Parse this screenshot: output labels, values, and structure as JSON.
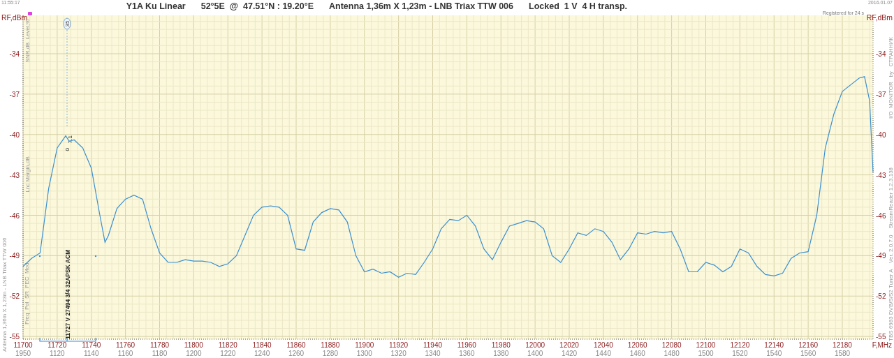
{
  "header": {
    "time": "11:55:17",
    "title_parts": [
      "Y1A Ku Linear",
      "52°5E  @  47.51°N : 19.20°E",
      "Antenna 1,36m X 1,23m - LNB Triax TTW 006",
      "Locked  1 V  4 H transp."
    ],
    "date": "2016.01.07",
    "registered": "Registered for 24 s"
  },
  "left_labels": {
    "ytick_labels": [
      "-34",
      "-37",
      "-40",
      "-43",
      "-46",
      "-49",
      "-52",
      "-55"
    ],
    "scales": [
      "Level,%",
      "SNR,dB",
      "Lnc Margin,dB"
    ],
    "info_fields": "Freq  Pol  SR  FEC  Mod",
    "antenna": "Antenna 1,36m X 1,23m - LNB Triax TTW 006"
  },
  "right_labels": {
    "unit": "RF,dBm",
    "brand": "I/O  MONITOR   by   СТРАННИК",
    "device": "TBS 6983 DVB/S/S2 Tuner A    Ver. 2.0.7.0    StreamReader 1.2.3.138"
  },
  "marker": {
    "badge": "35",
    "readings": [
      "0",
      "7.1"
    ],
    "transponder": "11727 V 27494 3/4 32APSK ACM"
  },
  "spectrum": {
    "secondary_xtick_labels": [
      "1950",
      "1120",
      "1140",
      "1160",
      "1180",
      "1200",
      "1220",
      "1240",
      "1260",
      "1280",
      "1300",
      "1320",
      "1340",
      "1360",
      "1380",
      "1400",
      "1420",
      "1440",
      "1460",
      "1480",
      "1500",
      "1520",
      "1540",
      "1560",
      "1580"
    ],
    "chart_data": {
      "type": "line",
      "ylabel": "RF,dBm",
      "xlabel": "F,MHz",
      "xlim": [
        11700,
        12198
      ],
      "ylim": [
        -55.2,
        -31.15
      ],
      "grid": true,
      "xticks": [
        11700,
        11720,
        11740,
        11760,
        11780,
        11800,
        11820,
        11840,
        11860,
        11880,
        11900,
        11920,
        11940,
        11960,
        11980,
        12000,
        12020,
        12040,
        12060,
        12080,
        12100,
        12120,
        12140,
        12160,
        12180
      ],
      "yticks": [
        -34,
        -37,
        -40,
        -43,
        -46,
        -49,
        -52,
        -55
      ],
      "x": [
        11700,
        11705,
        11710,
        11715,
        11720,
        11725,
        11727,
        11730,
        11735,
        11740,
        11745,
        11748,
        11750,
        11755,
        11760,
        11765,
        11770,
        11775,
        11780,
        11785,
        11790,
        11795,
        11800,
        11805,
        11810,
        11815,
        11820,
        11825,
        11830,
        11835,
        11840,
        11845,
        11850,
        11855,
        11860,
        11865,
        11870,
        11875,
        11880,
        11885,
        11890,
        11895,
        11900,
        11905,
        11910,
        11915,
        11920,
        11925,
        11930,
        11935,
        11940,
        11945,
        11950,
        11955,
        11960,
        11965,
        11970,
        11975,
        11980,
        11985,
        11990,
        11995,
        12000,
        12005,
        12010,
        12015,
        12020,
        12025,
        12030,
        12035,
        12040,
        12045,
        12050,
        12055,
        12060,
        12065,
        12070,
        12075,
        12080,
        12085,
        12090,
        12095,
        12100,
        12105,
        12110,
        12115,
        12120,
        12125,
        12130,
        12135,
        12140,
        12145,
        12150,
        12155,
        12160,
        12165,
        12170,
        12175,
        12180,
        12185,
        12190,
        12193,
        12196,
        12198
      ],
      "series": [
        {
          "color": "#3a8fd0",
          "values": [
            -49.8,
            -49.2,
            -48.8,
            -44,
            -41,
            -40.1,
            -40.5,
            -40.4,
            -41,
            -42.5,
            -46,
            -48,
            -47.5,
            -45.5,
            -44.8,
            -44.5,
            -44.8,
            -47,
            -48.8,
            -49.5,
            -49.5,
            -49.3,
            -49.4,
            -49.4,
            -49.5,
            -49.8,
            -49.6,
            -49,
            -47.5,
            -46,
            -45.4,
            -45.3,
            -45.4,
            -46,
            -48.5,
            -48.6,
            -46.5,
            -45.8,
            -45.5,
            -45.6,
            -46.5,
            -49,
            -50.2,
            -50,
            -50.3,
            -50.2,
            -50.6,
            -50.3,
            -50.4,
            -49.5,
            -48.5,
            -47,
            -46.3,
            -46.4,
            -46,
            -46.8,
            -48.5,
            -49.3,
            -48,
            -46.8,
            -46.6,
            -46.4,
            -46.5,
            -47,
            -49,
            -49.5,
            -48.5,
            -47.3,
            -47.5,
            -47,
            -47.2,
            -48,
            -49.3,
            -48.5,
            -47.3,
            -47.4,
            -47.2,
            -47.3,
            -47.2,
            -48.5,
            -50.2,
            -50.2,
            -49.5,
            -49.7,
            -50.2,
            -49.8,
            -48.5,
            -48.8,
            -49.8,
            -50.4,
            -50.5,
            -50.3,
            -49.2,
            -48.8,
            -48.7,
            -46,
            -41,
            -38.5,
            -36.8,
            -36.3,
            -35.8,
            -35.7,
            -37.5,
            -42.8
          ]
        }
      ]
    }
  }
}
